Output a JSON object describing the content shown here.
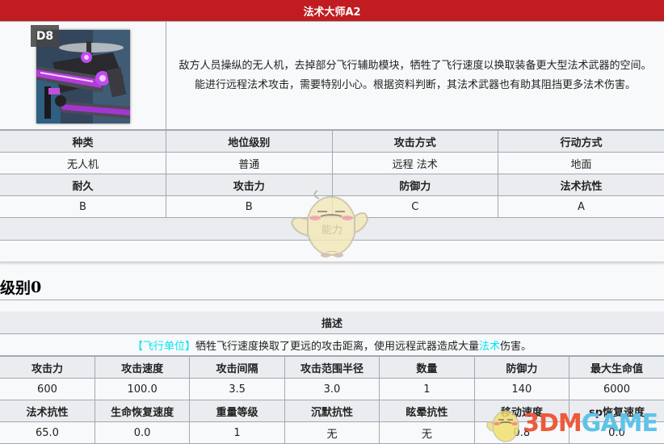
{
  "infobox": {
    "title": "法术大师A2",
    "code": "D8",
    "portrait_alt": "drone-with-purple-arcane-weapon",
    "description": "敌方人员操纵的无人机，去掉部分飞行辅助模块，牺牲了飞行速度以换取装备更大型法术武器的空间。能进行远程法术攻击，需要特别小心。根据资料判断，其法术武器也有助其阻挡更多法术伤害。",
    "attributes_row1": {
      "headers": [
        "种类",
        "地位级别",
        "攻击方式",
        "行动方式"
      ],
      "values": [
        "无人机",
        "普通",
        "远程 法术",
        "地面"
      ]
    },
    "attributes_row2": {
      "headers": [
        "耐久",
        "攻击力",
        "防御力",
        "法术抗性"
      ],
      "values": [
        "B",
        "B",
        "C",
        "A"
      ]
    },
    "ability": {
      "header": "能力",
      "value": "—"
    }
  },
  "level_section": {
    "heading": "级别",
    "level": "0"
  },
  "level_table": {
    "desc_header": "描述",
    "desc_tag": "【飞行单位】",
    "desc_text_1": "牺牲飞行速度换取了更远的攻击距离，使用远程武器造成大量",
    "desc_link": "法术",
    "desc_text_2": "伤害。",
    "stats_row1": {
      "headers": [
        "攻击力",
        "攻击速度",
        "攻击间隔",
        "攻击范围半径",
        "数量",
        "防御力",
        "最大生命值"
      ],
      "values": [
        "600",
        "100.0",
        "3.5",
        "3.0",
        "1",
        "140",
        "6000"
      ]
    },
    "stats_row2": {
      "headers": [
        "法术抗性",
        "生命恢复速度",
        "重量等级",
        "沉默抗性",
        "眩晕抗性",
        "移动速度",
        "sp恢复速度"
      ],
      "values": [
        "65.0",
        "0.0",
        "1",
        "无",
        "无",
        "0.8",
        "0.0"
      ]
    }
  },
  "watermark": {
    "part1": "3DM",
    "part2": "GAME"
  },
  "colors": {
    "title_bar": "#c11c21",
    "header_bg": "#eaecf0",
    "cell_bg": "#f8f9fa",
    "border": "#a2a9b1",
    "tag_cyan": "#00e5ee"
  }
}
